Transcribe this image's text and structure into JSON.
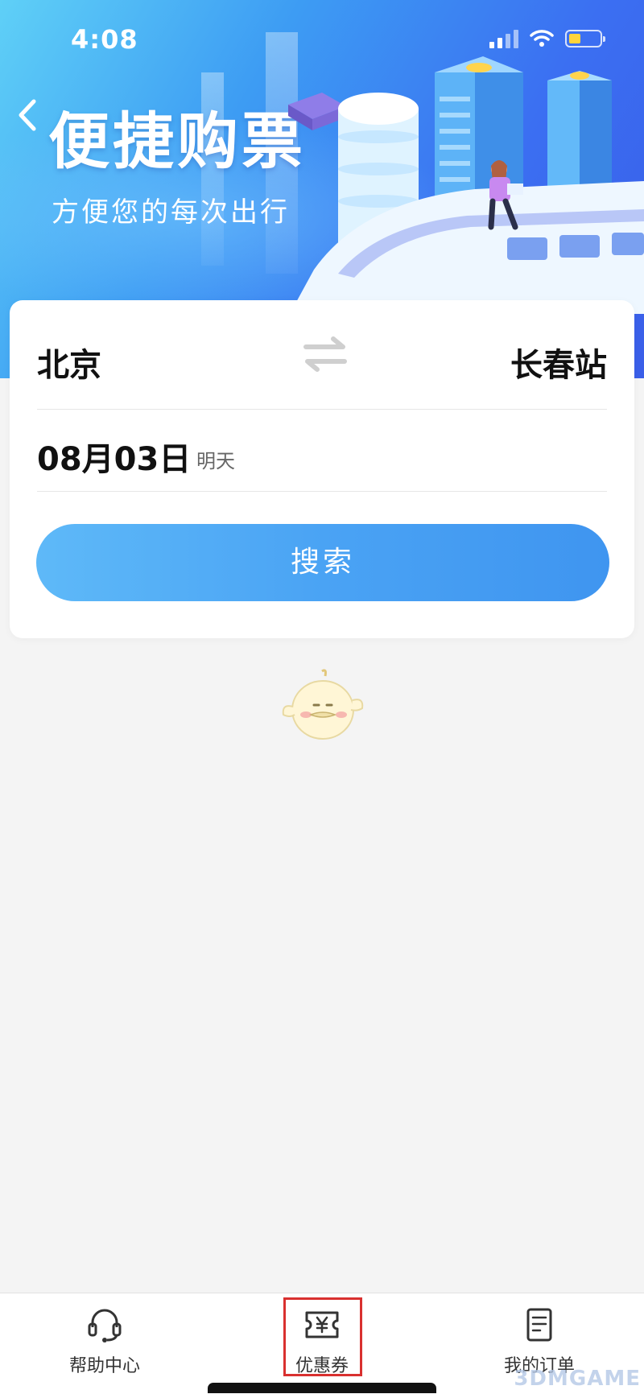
{
  "status_bar": {
    "time": "4:08"
  },
  "hero": {
    "title": "便捷购票",
    "subtitle": "方便您的每次出行"
  },
  "search_card": {
    "from_city": "北京",
    "to_city": "长春站",
    "date": "08月03日",
    "date_hint": "明天",
    "search_label": "搜索"
  },
  "tabbar": {
    "tabs": [
      {
        "label": "帮助中心",
        "icon": "headset-icon"
      },
      {
        "label": "优惠券",
        "icon": "coupon-yen-icon"
      },
      {
        "label": "我的订单",
        "icon": "order-list-icon"
      }
    ]
  },
  "colors": {
    "accent_blue": "#4aa3f4",
    "highlight_red": "#d9302f",
    "battery_yellow": "#ffd43b"
  },
  "watermark": "3DMGAME"
}
